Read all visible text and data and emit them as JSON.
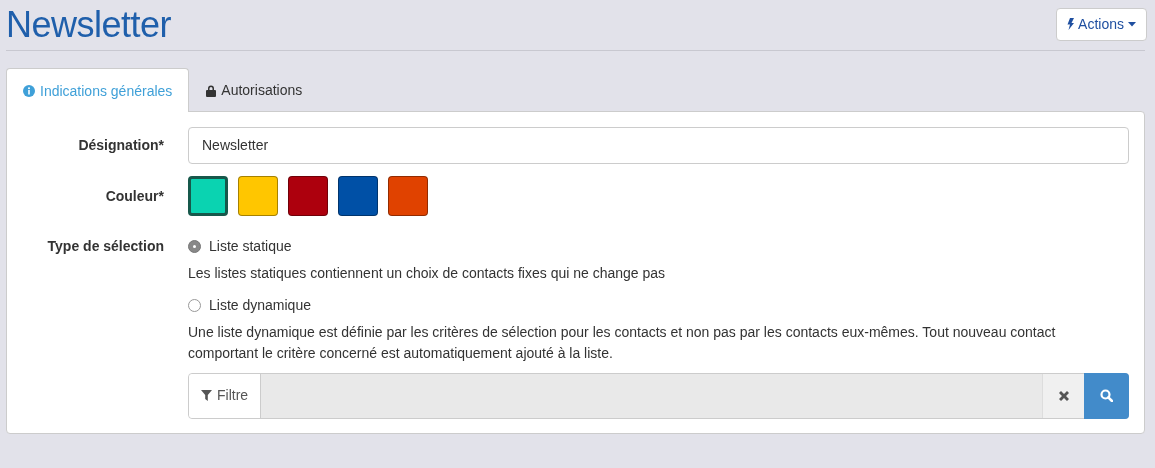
{
  "page": {
    "title": "Newsletter"
  },
  "actions_button": {
    "label": "Actions"
  },
  "tabs": [
    {
      "label": "Indications générales",
      "selected": true
    },
    {
      "label": "Autorisations",
      "selected": false
    }
  ],
  "designation": {
    "label": "Désignation*",
    "value": "Newsletter"
  },
  "colour": {
    "label": "Couleur*",
    "swatches": [
      {
        "color": "#0ad3b1",
        "selected": true
      },
      {
        "color": "#ffc600",
        "selected": false
      },
      {
        "color": "#ad000d",
        "selected": false
      },
      {
        "color": "#0050a6",
        "selected": false
      },
      {
        "color": "#e04200",
        "selected": false
      }
    ]
  },
  "selection_type": {
    "label": "Type de sélection",
    "options": [
      {
        "label": "Liste statique",
        "selected": true,
        "description": "Les listes statiques contiennent un choix de contacts fixes qui ne change pas"
      },
      {
        "label": "Liste dynamique",
        "selected": false,
        "description": "Une liste dynamique est définie par les critères de sélection pour les contacts et non pas par les contacts eux-mêmes. Tout nouveau contact comportant le critère concerné est automatiquement ajouté à la liste."
      }
    ]
  },
  "filter": {
    "label": "Filtre",
    "disabled": true
  }
}
